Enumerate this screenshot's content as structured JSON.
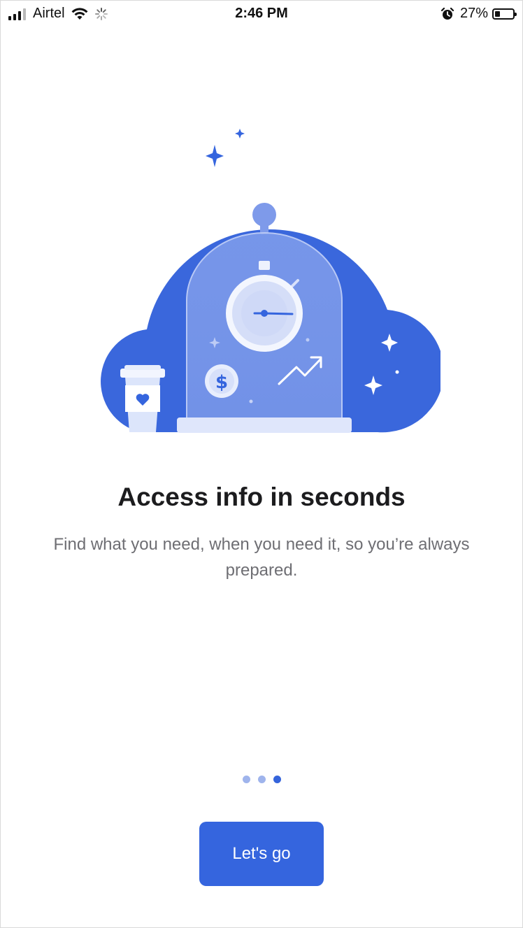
{
  "status_bar": {
    "carrier": "Airtel",
    "time": "2:46 PM",
    "battery_percent": "27%",
    "icons": [
      "signal-icon",
      "wifi-icon",
      "activity-spinner-icon",
      "alarm-icon",
      "battery-icon"
    ]
  },
  "onboarding": {
    "title": "Access info in seconds",
    "description": "Find what you need, when you need it, so you’re always prepared.",
    "page_indicator": {
      "total": 3,
      "current": 3
    },
    "cta_label": "Let's go"
  },
  "colors": {
    "accent": "#3565de",
    "cloud": "#3a67dc",
    "dot_inactive": "#9fb4ec",
    "title": "#1c1c1e",
    "body": "#6e6e73"
  }
}
